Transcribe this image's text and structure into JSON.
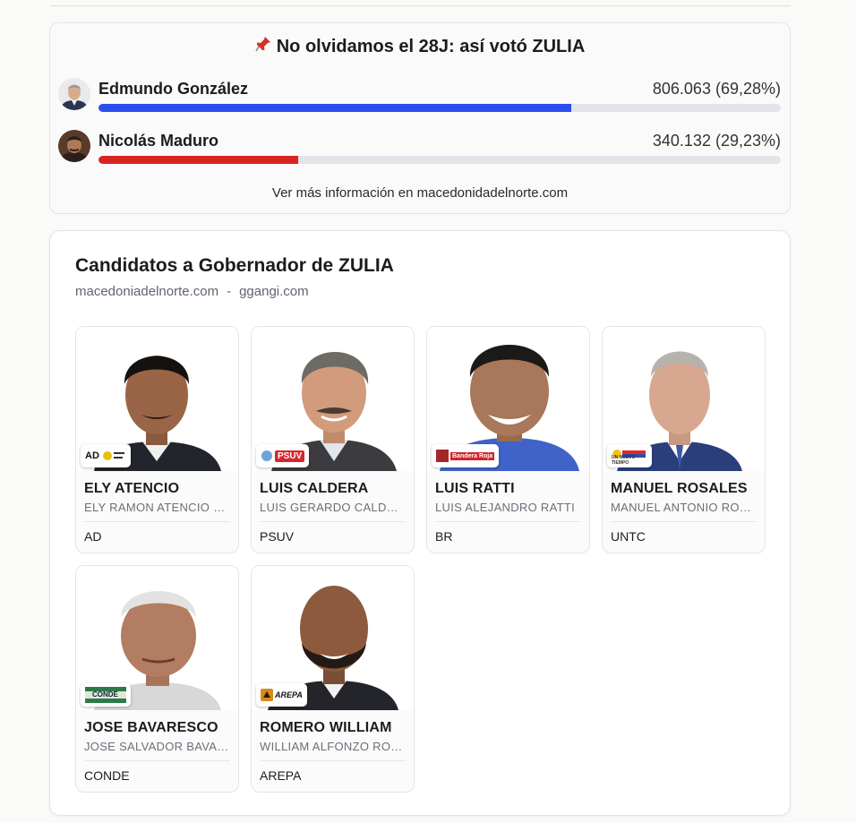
{
  "results": {
    "title": "No olvidamos el 28J: así votó ZULIA",
    "candidates": [
      {
        "name": "Edmundo González",
        "votes": "806.063 (69,28%)",
        "percent": 69.28,
        "color": "#2c4ded"
      },
      {
        "name": "Nicolás Maduro",
        "votes": "340.132 (29,23%)",
        "percent": 29.23,
        "color": "#d92520"
      }
    ],
    "more_info": "Ver más información en macedonidadelnorte.com"
  },
  "governor": {
    "title": "Candidatos a Gobernador de ZULIA",
    "source_1": "macedoniadelnorte.com",
    "source_sep": "-",
    "source_2": "ggangi.com",
    "candidates": [
      {
        "name": "ELY ATENCIO",
        "full_name": "ELY RAMON ATENCIO CONTRERAS",
        "party": "AD",
        "logo_text": "AD"
      },
      {
        "name": "LUIS CALDERA",
        "full_name": "LUIS GERARDO CALDERA",
        "party": "PSUV",
        "logo_text": "PSUV"
      },
      {
        "name": "LUIS RATTI",
        "full_name": "LUIS ALEJANDRO RATTI",
        "party": "BR",
        "logo_text": "Bandera Roja"
      },
      {
        "name": "MANUEL ROSALES",
        "full_name": "MANUEL ANTONIO ROSALES",
        "party": "UNTC",
        "logo_text": "UN NUEVO TIEMPO"
      },
      {
        "name": "JOSE BAVARESCO",
        "full_name": "JOSE SALVADOR BAVARESCO",
        "party": "CONDE",
        "logo_text": "CONDE"
      },
      {
        "name": "ROMERO WILLIAM",
        "full_name": "WILLIAM ALFONZO ROMERO",
        "party": "AREPA",
        "logo_text": "AREPA"
      }
    ]
  }
}
